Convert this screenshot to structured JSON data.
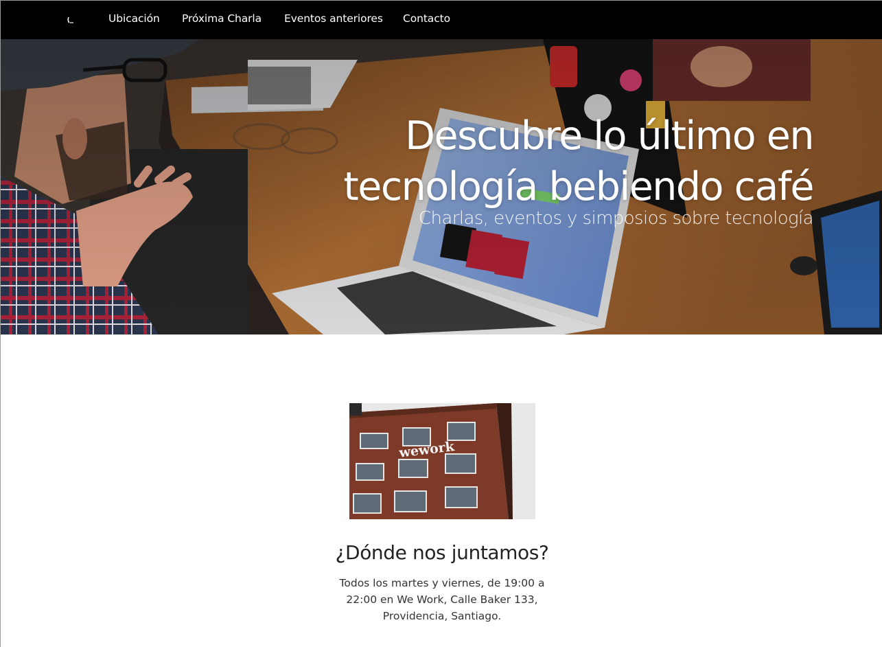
{
  "nav": {
    "items": [
      {
        "label": "Ubicación"
      },
      {
        "label": "Próxima Charla"
      },
      {
        "label": "Eventos anteriores"
      },
      {
        "label": "Contacto"
      }
    ]
  },
  "hero": {
    "title": "Descubre lo último en tecnología bebiendo café",
    "subtitle": "Charlas, eventos y simposios sobre tecnología"
  },
  "location": {
    "image_sign": "wework",
    "heading": "¿Dónde nos juntamos?",
    "text": "Todos los martes y viernes, de 19:00 a 22:00 en We Work, Calle Baker 133, Providencia, Santiago."
  },
  "colors": {
    "navbar_bg": "#000000",
    "nav_text": "#ffffff",
    "heading_text": "#222222",
    "body_text": "#333333"
  }
}
